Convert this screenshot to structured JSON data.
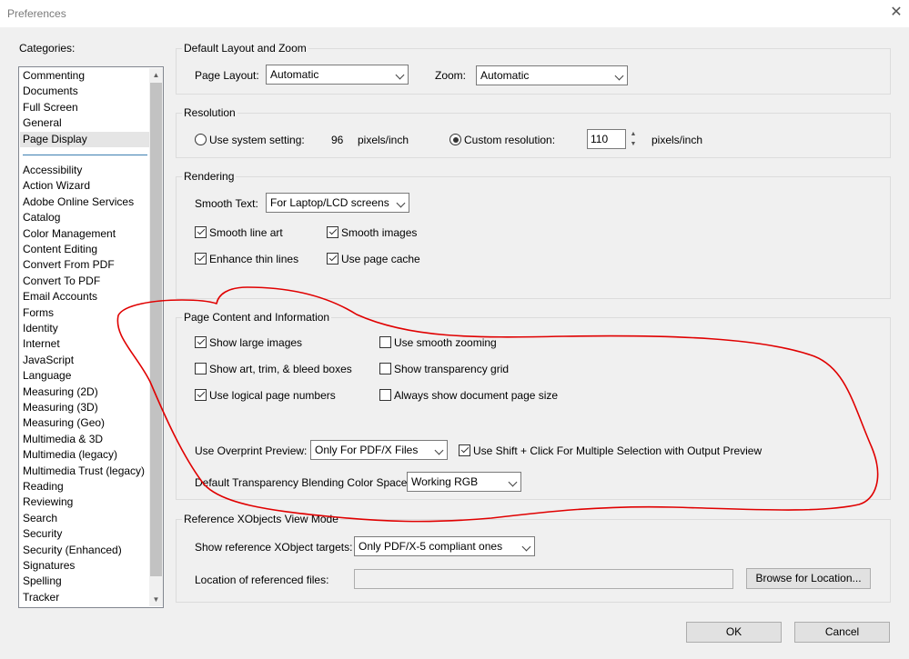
{
  "window": {
    "title": "Preferences",
    "close_icon": "close-icon"
  },
  "categories": {
    "label": "Categories:",
    "top_items": [
      "Commenting",
      "Documents",
      "Full Screen",
      "General",
      "Page Display"
    ],
    "selected": "Page Display",
    "items": [
      "Accessibility",
      "Action Wizard",
      "Adobe Online Services",
      "Catalog",
      "Color Management",
      "Content Editing",
      "Convert From PDF",
      "Convert To PDF",
      "Email Accounts",
      "Forms",
      "Identity",
      "Internet",
      "JavaScript",
      "Language",
      "Measuring (2D)",
      "Measuring (3D)",
      "Measuring (Geo)",
      "Multimedia & 3D",
      "Multimedia (legacy)",
      "Multimedia Trust (legacy)",
      "Reading",
      "Reviewing",
      "Search",
      "Security",
      "Security (Enhanced)",
      "Signatures",
      "Spelling",
      "Tracker"
    ]
  },
  "layout_zoom": {
    "title": "Default Layout and Zoom",
    "page_layout_label": "Page Layout:",
    "page_layout_value": "Automatic",
    "zoom_label": "Zoom:",
    "zoom_value": "Automatic"
  },
  "resolution": {
    "title": "Resolution",
    "system_label": "Use system setting:",
    "system_value": "96",
    "system_unit": "pixels/inch",
    "custom_label": "Custom resolution:",
    "custom_value": "110",
    "custom_unit": "pixels/inch",
    "selected": "custom"
  },
  "rendering": {
    "title": "Rendering",
    "smooth_text_label": "Smooth Text:",
    "smooth_text_value": "For Laptop/LCD screens",
    "smooth_line_art": "Smooth line art",
    "smooth_images": "Smooth images",
    "enhance_thin_lines": "Enhance thin lines",
    "use_page_cache": "Use page cache",
    "checked": {
      "smooth_line_art": true,
      "smooth_images": true,
      "enhance_thin_lines": true,
      "use_page_cache": true
    }
  },
  "page_content": {
    "title": "Page Content and Information",
    "show_large_images": "Show large images",
    "use_smooth_zooming": "Use smooth zooming",
    "show_bleed_boxes": "Show art, trim, & bleed boxes",
    "show_transparency_grid": "Show transparency grid",
    "use_logical_page_numbers": "Use logical page numbers",
    "always_show_page_size": "Always show document page size",
    "overprint_label": "Use Overprint Preview:",
    "overprint_value": "Only For PDF/X Files",
    "shift_click": "Use Shift + Click For Multiple Selection with Output Preview",
    "blend_label": "Default Transparency Blending Color Space:",
    "blend_value": "Working RGB",
    "checked": {
      "show_large_images": true,
      "use_smooth_zooming": false,
      "show_bleed_boxes": false,
      "show_transparency_grid": false,
      "use_logical_page_numbers": true,
      "always_show_page_size": false,
      "shift_click": true
    }
  },
  "xobjects": {
    "title": "Reference XObjects View Mode",
    "targets_label": "Show reference XObject targets:",
    "targets_value": "Only PDF/X-5 compliant ones",
    "location_label": "Location of referenced files:",
    "location_value": "",
    "browse_label": "Browse for Location..."
  },
  "footer": {
    "ok_label": "OK",
    "cancel_label": "Cancel"
  },
  "annotation": {
    "stroke_color": "#e00000"
  }
}
